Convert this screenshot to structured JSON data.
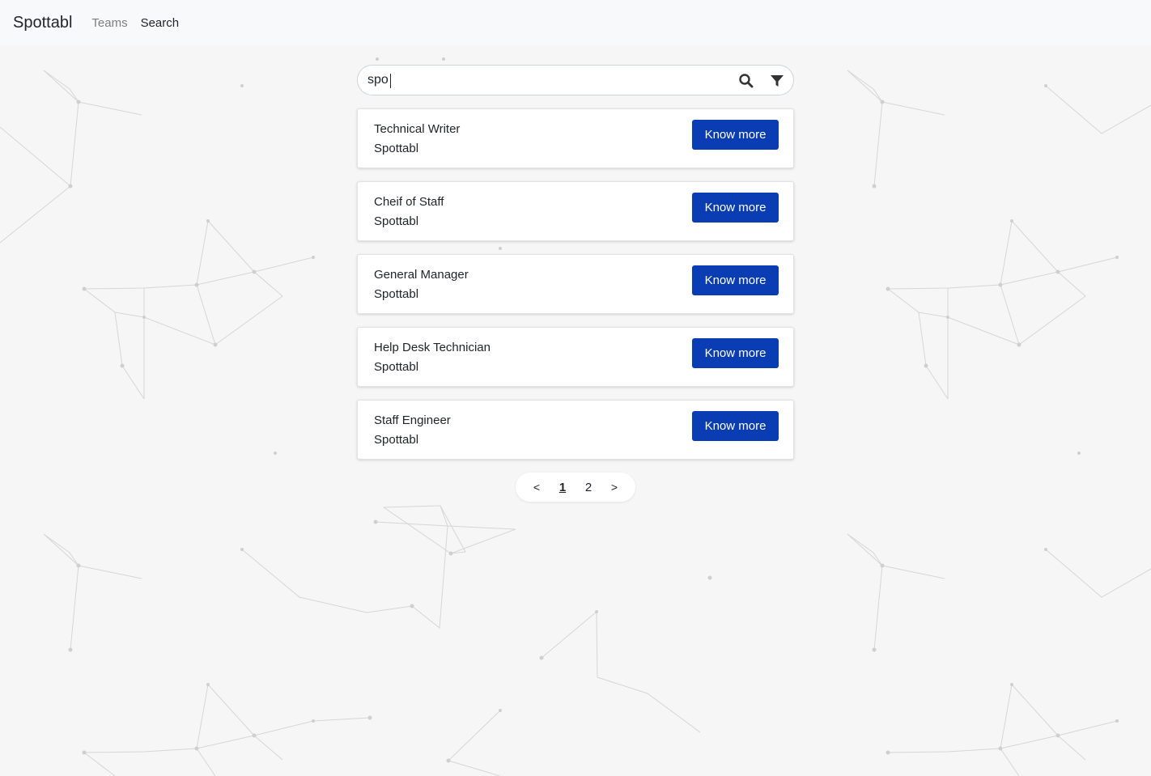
{
  "navbar": {
    "brand": "Spottabl",
    "links": [
      {
        "label": "Teams",
        "active": false
      },
      {
        "label": "Search",
        "active": true
      }
    ]
  },
  "search": {
    "value": "spo",
    "placeholder": ""
  },
  "icons": {
    "search": "search-icon",
    "filter": "filter-icon"
  },
  "results": [
    {
      "title": "Technical Writer",
      "company": "Spottabl",
      "action": "Know more"
    },
    {
      "title": "Cheif of Staff",
      "company": "Spottabl",
      "action": "Know more"
    },
    {
      "title": "General Manager",
      "company": "Spottabl",
      "action": "Know more"
    },
    {
      "title": "Help Desk Technician",
      "company": "Spottabl",
      "action": "Know more"
    },
    {
      "title": "Staff Engineer",
      "company": "Spottabl",
      "action": "Know more"
    }
  ],
  "pagination": {
    "prev": "<",
    "pages": [
      "1",
      "2"
    ],
    "current": "1",
    "next": ">"
  },
  "colors": {
    "accent": "#0a3cb4",
    "background": "#f6f6f7",
    "navbar": "#f8f9fa"
  }
}
